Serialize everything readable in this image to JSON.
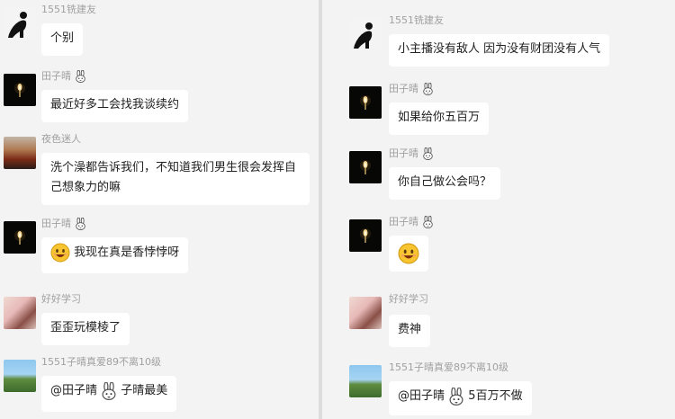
{
  "left": {
    "messages": [
      {
        "nick": "1551铣建友",
        "text": "个别"
      },
      {
        "nick": "田子晴",
        "text": "最近好多工会找我谈续约"
      },
      {
        "nick": "夜色迷人",
        "text": "洗个澡都告诉我们，不知道我们男生很会发挥自己想象力的嘛"
      },
      {
        "nick": "田子晴",
        "text": "我现在真是香悖悖呀"
      },
      {
        "nick": "好好学习",
        "text": "歪歪玩模棱了"
      },
      {
        "nick": "1551子晴真爱89不离10级",
        "mention": "@田子晴",
        "text": "子晴最美"
      }
    ]
  },
  "right": {
    "messages": [
      {
        "nick": "1551铣建友",
        "text": "小主播没有敌人  因为没有财团没有人气"
      },
      {
        "nick": "田子晴",
        "text": "如果给你五百万"
      },
      {
        "nick": "田子晴",
        "text": "你自己做公会吗？"
      },
      {
        "nick": "田子晴",
        "text": ""
      },
      {
        "nick": "好好学习",
        "text": "费神"
      },
      {
        "nick": "1551子晴真爱89不离10级",
        "mention": "@田子晴",
        "text": "5百万不做"
      }
    ]
  },
  "icons": {
    "rabbit": "rabbit-icon",
    "smile": "smile-emoji-icon",
    "candle": "candle-avatar"
  }
}
